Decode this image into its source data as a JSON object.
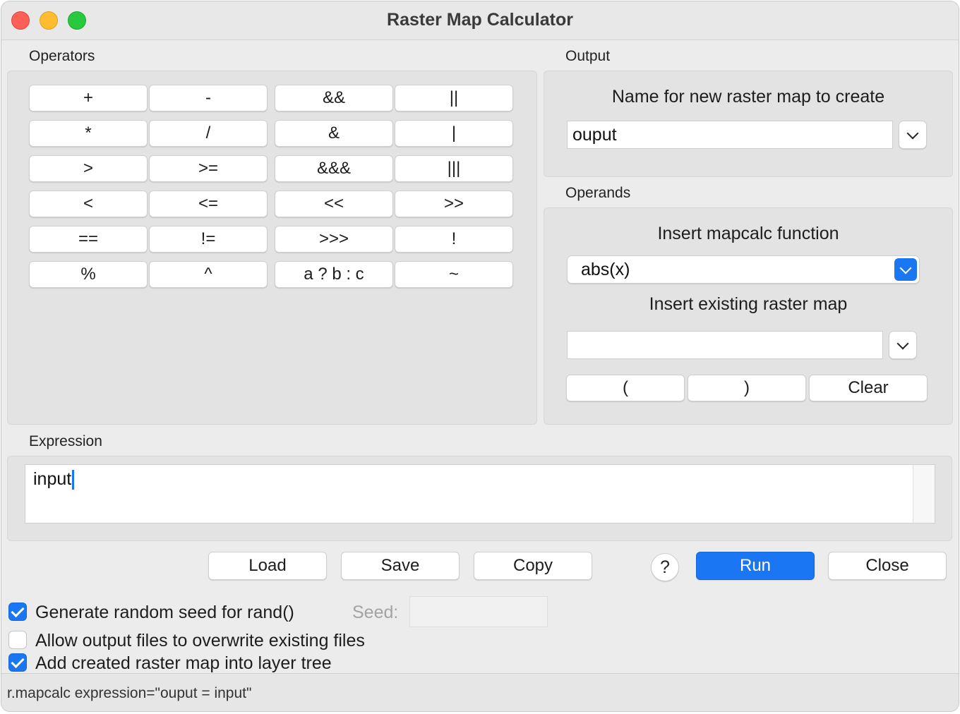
{
  "window": {
    "title": "Raster Map Calculator"
  },
  "operators": {
    "label": "Operators",
    "rows": [
      [
        "+",
        "-",
        "&&",
        "||"
      ],
      [
        "*",
        "/",
        "&",
        "|"
      ],
      [
        ">",
        ">=",
        "&&&",
        "|||"
      ],
      [
        "<",
        "<=",
        "<<",
        ">>"
      ],
      [
        "==",
        "!=",
        ">>>",
        "!"
      ],
      [
        "%",
        "^",
        "a ? b : c",
        "~"
      ]
    ]
  },
  "output": {
    "label": "Output",
    "name_label": "Name for new raster map to create",
    "name_value": "ouput"
  },
  "operands": {
    "label": "Operands",
    "function_label": "Insert mapcalc function",
    "function_value": "abs(x)",
    "raster_label": "Insert existing raster map",
    "raster_value": "",
    "open_paren": "(",
    "close_paren": ")",
    "clear": "Clear"
  },
  "expression": {
    "label": "Expression",
    "value": "input"
  },
  "actions": {
    "load": "Load",
    "save": "Save",
    "copy": "Copy",
    "help": "?",
    "run": "Run",
    "close": "Close"
  },
  "options": {
    "random_seed": {
      "label": "Generate random seed for rand()",
      "checked": true
    },
    "seed_label": "Seed:",
    "seed_value": "",
    "overwrite": {
      "label": "Allow output files to overwrite existing files",
      "checked": false
    },
    "add_layer": {
      "label": "Add created raster map into layer tree",
      "checked": true
    }
  },
  "status": {
    "command": "r.mapcalc expression=\"ouput = input\""
  },
  "colors": {
    "accent": "#1a76f2",
    "close": "#fe5f57",
    "minimize": "#febc2e",
    "maximize": "#28c840"
  }
}
